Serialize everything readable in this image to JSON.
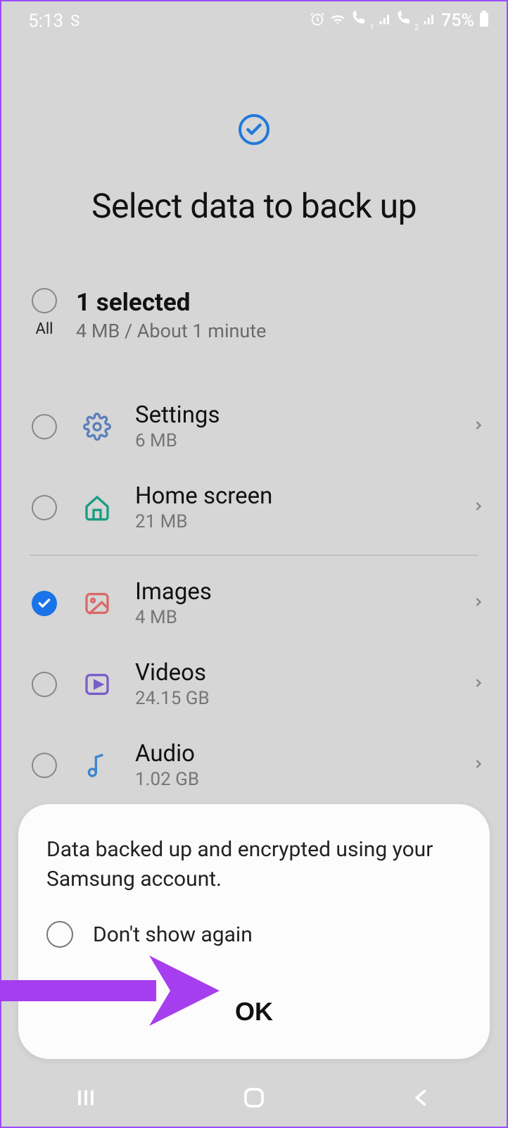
{
  "status": {
    "time": "5:13",
    "indicator": "S",
    "battery": "75%"
  },
  "header": {
    "title": "Select data to back up"
  },
  "summary": {
    "all_label": "All",
    "selected_count": "1 selected",
    "meta": "4 MB / About 1 minute"
  },
  "items": [
    {
      "title": "Settings",
      "sub": "6 MB",
      "icon": "gear-icon",
      "checked": false
    },
    {
      "title": "Home screen",
      "sub": "21 MB",
      "icon": "home-icon",
      "checked": false
    },
    {
      "title": "Images",
      "sub": "4 MB",
      "icon": "image-icon",
      "checked": true
    },
    {
      "title": "Videos",
      "sub": "24.15 GB",
      "icon": "video-icon",
      "checked": false
    },
    {
      "title": "Audio",
      "sub": "1.02 GB",
      "icon": "audio-icon",
      "checked": false
    }
  ],
  "dialog": {
    "message": "Data backed up and encrypted using your Samsung account.",
    "dont_show_label": "Don't show again",
    "ok_label": "OK"
  }
}
